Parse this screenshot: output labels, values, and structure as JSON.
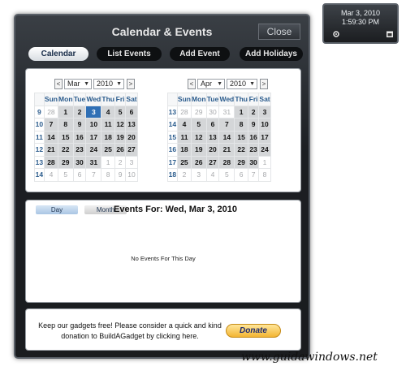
{
  "clock": {
    "date": "Mar 3, 2010",
    "time": "1:59:30 PM",
    "icons": [
      "settings-icon",
      "calendar-icon"
    ]
  },
  "gadget": {
    "title": "Calendar & Events",
    "close_label": "Close",
    "tabs": [
      {
        "label": "Calendar",
        "active": true
      },
      {
        "label": "List Events",
        "active": false
      },
      {
        "label": "Add Event",
        "active": false
      },
      {
        "label": "Add Holidays",
        "active": false
      }
    ]
  },
  "calendar": {
    "weekday_headers": [
      "Sun",
      "Mon",
      "Tue",
      "Wed",
      "Thu",
      "Fri",
      "Sat"
    ],
    "months": [
      {
        "month": "Mar",
        "year": "2010",
        "weeks": [
          {
            "wk": "9",
            "days": [
              {
                "d": "28",
                "cur": false
              },
              {
                "d": "1",
                "cur": true
              },
              {
                "d": "2",
                "cur": true
              },
              {
                "d": "3",
                "cur": true,
                "today": true
              },
              {
                "d": "4",
                "cur": true
              },
              {
                "d": "5",
                "cur": true
              },
              {
                "d": "6",
                "cur": true
              }
            ]
          },
          {
            "wk": "10",
            "days": [
              {
                "d": "7",
                "cur": true
              },
              {
                "d": "8",
                "cur": true
              },
              {
                "d": "9",
                "cur": true
              },
              {
                "d": "10",
                "cur": true
              },
              {
                "d": "11",
                "cur": true
              },
              {
                "d": "12",
                "cur": true
              },
              {
                "d": "13",
                "cur": true
              }
            ]
          },
          {
            "wk": "11",
            "days": [
              {
                "d": "14",
                "cur": true
              },
              {
                "d": "15",
                "cur": true
              },
              {
                "d": "16",
                "cur": true
              },
              {
                "d": "17",
                "cur": true
              },
              {
                "d": "18",
                "cur": true
              },
              {
                "d": "19",
                "cur": true
              },
              {
                "d": "20",
                "cur": true
              }
            ]
          },
          {
            "wk": "12",
            "days": [
              {
                "d": "21",
                "cur": true
              },
              {
                "d": "22",
                "cur": true
              },
              {
                "d": "23",
                "cur": true
              },
              {
                "d": "24",
                "cur": true
              },
              {
                "d": "25",
                "cur": true
              },
              {
                "d": "26",
                "cur": true
              },
              {
                "d": "27",
                "cur": true
              }
            ]
          },
          {
            "wk": "13",
            "days": [
              {
                "d": "28",
                "cur": true
              },
              {
                "d": "29",
                "cur": true
              },
              {
                "d": "30",
                "cur": true
              },
              {
                "d": "31",
                "cur": true
              },
              {
                "d": "1",
                "cur": false
              },
              {
                "d": "2",
                "cur": false
              },
              {
                "d": "3",
                "cur": false
              }
            ]
          },
          {
            "wk": "14",
            "days": [
              {
                "d": "4",
                "cur": false
              },
              {
                "d": "5",
                "cur": false
              },
              {
                "d": "6",
                "cur": false
              },
              {
                "d": "7",
                "cur": false
              },
              {
                "d": "8",
                "cur": false
              },
              {
                "d": "9",
                "cur": false
              },
              {
                "d": "10",
                "cur": false
              }
            ]
          }
        ]
      },
      {
        "month": "Apr",
        "year": "2010",
        "weeks": [
          {
            "wk": "13",
            "days": [
              {
                "d": "28",
                "cur": false
              },
              {
                "d": "29",
                "cur": false
              },
              {
                "d": "30",
                "cur": false
              },
              {
                "d": "31",
                "cur": false
              },
              {
                "d": "1",
                "cur": true
              },
              {
                "d": "2",
                "cur": true
              },
              {
                "d": "3",
                "cur": true
              }
            ]
          },
          {
            "wk": "14",
            "days": [
              {
                "d": "4",
                "cur": true
              },
              {
                "d": "5",
                "cur": true
              },
              {
                "d": "6",
                "cur": true
              },
              {
                "d": "7",
                "cur": true
              },
              {
                "d": "8",
                "cur": true
              },
              {
                "d": "9",
                "cur": true
              },
              {
                "d": "10",
                "cur": true
              }
            ]
          },
          {
            "wk": "15",
            "days": [
              {
                "d": "11",
                "cur": true
              },
              {
                "d": "12",
                "cur": true
              },
              {
                "d": "13",
                "cur": true
              },
              {
                "d": "14",
                "cur": true
              },
              {
                "d": "15",
                "cur": true
              },
              {
                "d": "16",
                "cur": true
              },
              {
                "d": "17",
                "cur": true
              }
            ]
          },
          {
            "wk": "16",
            "days": [
              {
                "d": "18",
                "cur": true
              },
              {
                "d": "19",
                "cur": true
              },
              {
                "d": "20",
                "cur": true
              },
              {
                "d": "21",
                "cur": true
              },
              {
                "d": "22",
                "cur": true
              },
              {
                "d": "23",
                "cur": true
              },
              {
                "d": "24",
                "cur": true
              }
            ]
          },
          {
            "wk": "17",
            "days": [
              {
                "d": "25",
                "cur": true
              },
              {
                "d": "26",
                "cur": true
              },
              {
                "d": "27",
                "cur": true
              },
              {
                "d": "28",
                "cur": true
              },
              {
                "d": "29",
                "cur": true
              },
              {
                "d": "30",
                "cur": true
              },
              {
                "d": "1",
                "cur": false
              }
            ]
          },
          {
            "wk": "18",
            "days": [
              {
                "d": "2",
                "cur": false
              },
              {
                "d": "3",
                "cur": false
              },
              {
                "d": "4",
                "cur": false
              },
              {
                "d": "5",
                "cur": false
              },
              {
                "d": "6",
                "cur": false
              },
              {
                "d": "7",
                "cur": false
              },
              {
                "d": "8",
                "cur": false
              }
            ]
          }
        ]
      }
    ]
  },
  "events": {
    "day_label": "Day",
    "month_label": "Month",
    "title": "Events For: Wed, Mar 3, 2010",
    "empty_text": "No Events For This Day"
  },
  "donate": {
    "text": "Keep our gadgets free! Please consider a quick and kind donation to BuildAGadget by clicking here.",
    "button_label": "Donate"
  },
  "watermark": "www.guidawindows.net",
  "colors": {
    "today": "#2f6fb5",
    "week_number": "#2a5b8c",
    "donate": "#f3b533"
  }
}
